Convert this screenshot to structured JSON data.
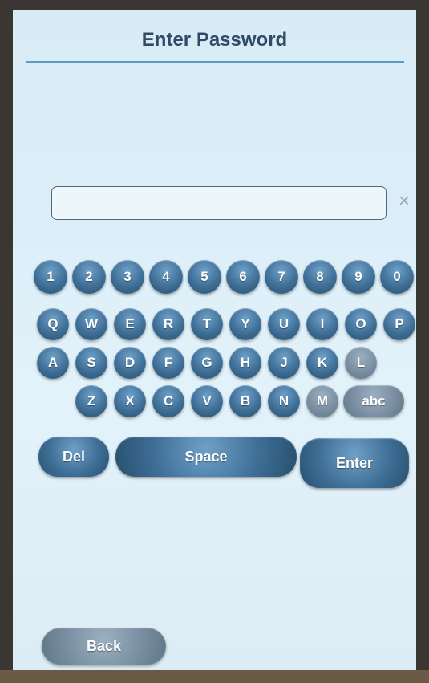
{
  "header": {
    "title": "Enter Password"
  },
  "password": {
    "value": ""
  },
  "clear_button": {
    "glyph": "×"
  },
  "keyboard": {
    "digits": [
      "1",
      "2",
      "3",
      "4",
      "5",
      "6",
      "7",
      "8",
      "9",
      "0"
    ],
    "row_q": [
      "Q",
      "W",
      "E",
      "R",
      "T",
      "Y",
      "U",
      "I",
      "O",
      "P"
    ],
    "row_a": [
      "A",
      "S",
      "D",
      "F",
      "G",
      "H",
      "J",
      "K",
      "L"
    ],
    "row_z": [
      "Z",
      "X",
      "C",
      "V",
      "B",
      "N",
      "M"
    ],
    "case_toggle_label": "abc",
    "del_label": "Del",
    "space_label": "Space",
    "enter_label": "Enter"
  },
  "footer": {
    "back_label": "Back"
  },
  "colors": {
    "key_blue": "#3f6f96",
    "title_text": "#2f4b66",
    "divider": "#5b9bc9",
    "screen_bg": "#dbeef8"
  }
}
